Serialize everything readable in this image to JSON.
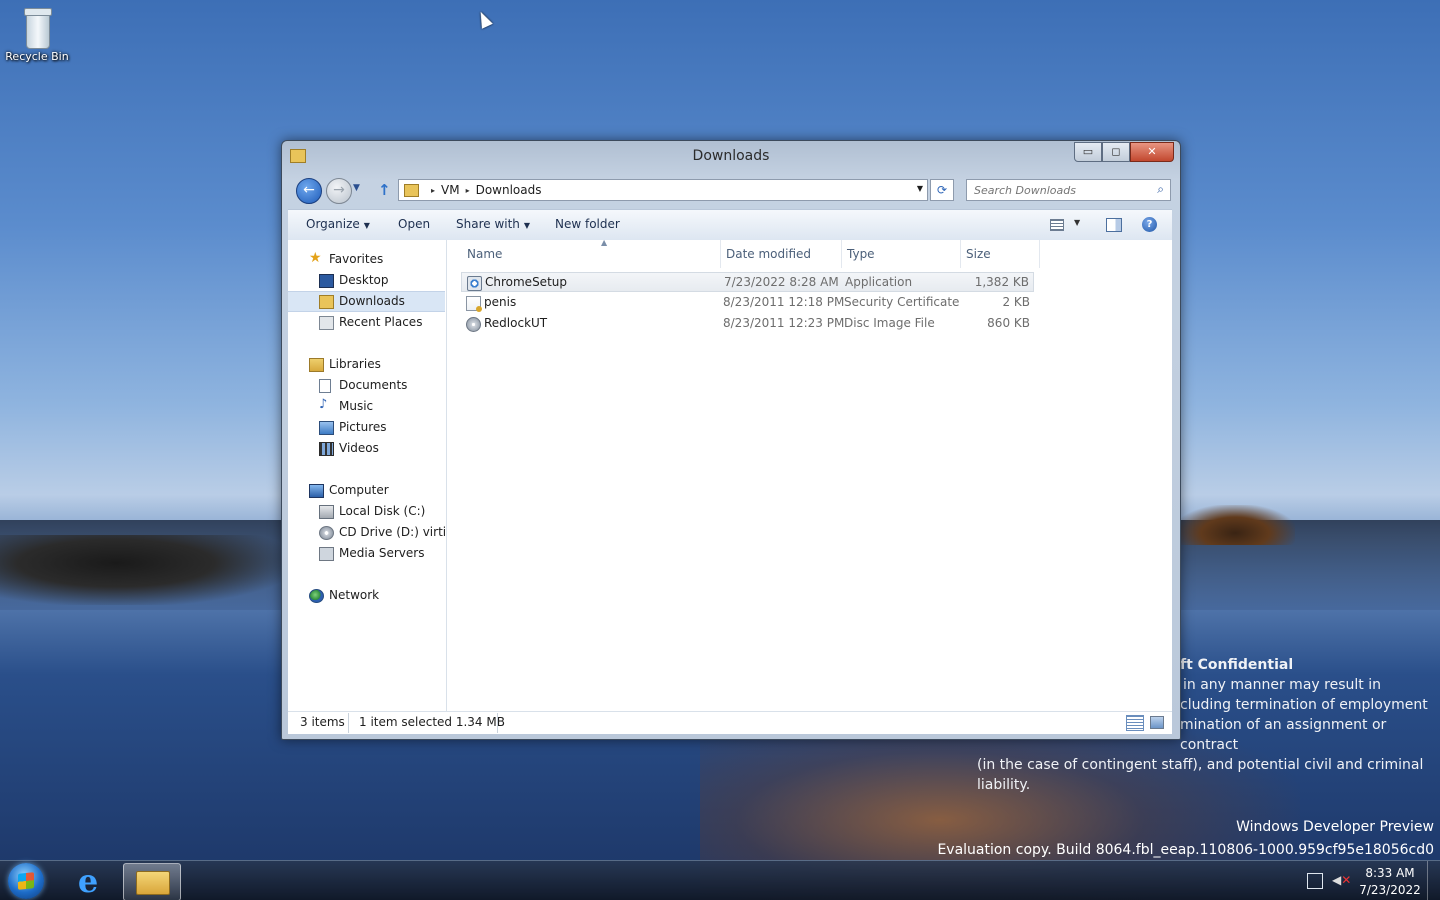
{
  "desktop": {
    "recycle_bin_label": "Recycle Bin",
    "confidential": {
      "title": "ft Confidential",
      "line1": "in any manner may result in",
      "line2": "cluding termination of employment",
      "line3": "mination of an assignment or contract",
      "line4": "(in the case of contingent staff), and potential civil and criminal",
      "line5": "liability."
    },
    "watermark": {
      "edition": "Windows Developer Preview",
      "build": "Evaluation copy. Build 8064.fbl_eeap.110806-1000.959cf95e18056cd0"
    }
  },
  "window": {
    "title": "Downloads",
    "caption": {
      "minimize": "▭",
      "maximize": "◻",
      "close": "✕"
    },
    "address": {
      "crumbs": [
        "VM",
        "Downloads"
      ],
      "separator": "▸"
    },
    "search_placeholder": "Search Downloads",
    "toolbar": {
      "organize": "Organize",
      "open": "Open",
      "share_with": "Share with",
      "new_folder": "New folder"
    },
    "nav": {
      "favorites": "Favorites",
      "desktop": "Desktop",
      "downloads": "Downloads",
      "recent_places": "Recent Places",
      "libraries": "Libraries",
      "documents": "Documents",
      "music": "Music",
      "pictures": "Pictures",
      "videos": "Videos",
      "computer": "Computer",
      "local_disk": "Local Disk (C:)",
      "cd_drive": "CD Drive (D:) virtio-win",
      "media_servers": "Media Servers",
      "network": "Network"
    },
    "columns": {
      "name": "Name",
      "date_modified": "Date modified",
      "type": "Type",
      "size": "Size"
    },
    "files": [
      {
        "name": "ChromeSetup",
        "date": "7/23/2022 8:28 AM",
        "type": "Application",
        "size": "1,382 KB",
        "icon": "application-icon",
        "selected": true
      },
      {
        "name": "penis",
        "date": "8/23/2011 12:18 PM",
        "type": "Security Certificate",
        "size": "2 KB",
        "icon": "certificate-icon",
        "selected": false
      },
      {
        "name": "RedlockUT",
        "date": "8/23/2011 12:23 PM",
        "type": "Disc Image File",
        "size": "860 KB",
        "icon": "disc-image-icon",
        "selected": false
      }
    ],
    "status": {
      "item_count": "3 items",
      "selection": "1 item selected  1.34 MB"
    }
  },
  "taskbar": {
    "clock_time": "8:33 AM",
    "clock_date": "7/23/2022",
    "ie_glyph": "e"
  }
}
